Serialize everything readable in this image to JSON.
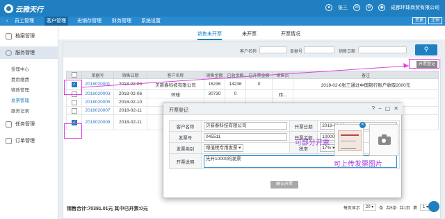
{
  "app": {
    "name": "云雅天行",
    "user": "张三",
    "company": "成都环球商贸有限公司"
  },
  "nav": {
    "items": [
      "员工管理",
      "客户管理",
      "进销存管理",
      "财务管理",
      "系统设置"
    ],
    "active": 1,
    "right": [
      "变更",
      "注销"
    ]
  },
  "sidebar": {
    "groups": [
      {
        "label": "档案管理"
      },
      {
        "label": "服务管理"
      },
      {
        "label": "任务管理"
      },
      {
        "label": "订单管理"
      }
    ],
    "items": [
      "受理中心",
      "费用缴费",
      "物质管理",
      "发票管理",
      "服务记录"
    ]
  },
  "tabs": [
    "销售未开票",
    "未开票",
    "开票情况"
  ],
  "search": {
    "labels": [
      "客户名称",
      "单据号",
      "销售日期"
    ],
    "button_icon": "search-icon"
  },
  "toolbar": {
    "invoice_register": "开票登记"
  },
  "table": {
    "headers": [
      "",
      "单据号",
      "销售日期",
      "客户名称",
      "销售金额",
      "已收金额",
      "已开票金额",
      "销售员",
      "备注"
    ],
    "rows": [
      {
        "id": "2018020001",
        "date": "2018-02-06",
        "customer": "贝新春科技有限公司",
        "amount": "16236",
        "received": "14236",
        "invoiced": "0",
        "sales": "",
        "note": "2018-02-6张三通过中国银行账户收取2000元",
        "checked": true
      },
      {
        "id": "2018020003",
        "date": "2018-02-06",
        "customer": "环球",
        "amount": "30730",
        "received": "0",
        "invoiced": "",
        "sales": "邓...",
        "note": "",
        "checked": false
      },
      {
        "id": "2018020005",
        "date": "2018-02-10",
        "customer": "",
        "amount": "",
        "received": "",
        "invoiced": "",
        "sales": "",
        "note": "",
        "checked": false
      },
      {
        "id": "2018020007",
        "date": "2018-02-11",
        "customer": "",
        "amount": "",
        "received": "",
        "invoiced": "",
        "sales": "",
        "note": "",
        "checked": false
      },
      {
        "id": "2018020008",
        "date": "2018-02-11",
        "customer": "",
        "amount": "",
        "received": "",
        "invoiced": "",
        "sales": "",
        "note": "",
        "checked": true
      }
    ]
  },
  "footer": {
    "total": "销售合计:70391.01元 其中已开票:0元",
    "per_page_label": "每页显示",
    "per_page": "20",
    "unit": "条",
    "total_count": "共5条",
    "pages": "共1页",
    "page_prefix": "第",
    "page": "1",
    "page_suffix": "页"
  },
  "modal": {
    "title": "开票登记",
    "fields": {
      "customer_label": "客户名称",
      "customer": "贝新春科技有限公司",
      "date_label": "开票日期",
      "date": "2018-02-11",
      "invoice_no_label": "发票号",
      "invoice_no": "045511",
      "amount_label": "开票金额",
      "amount": "10000",
      "type_label": "发票类别",
      "type": "增值税专用发票",
      "tax_label": "税率",
      "tax": "17%",
      "desc_label": "开票说明",
      "desc": "先开10000的发票"
    },
    "confirm": "确认开票"
  },
  "annotations": {
    "partial": "可部分开票",
    "upload": "可上传发票图片"
  }
}
